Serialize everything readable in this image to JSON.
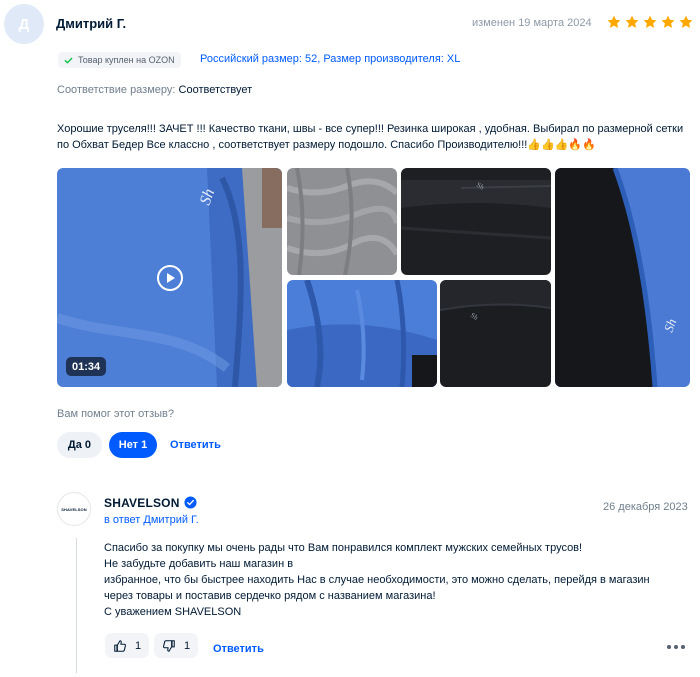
{
  "review": {
    "avatar_letter": "Д",
    "author": "Дмитрий Г.",
    "edited": "изменен 19 марта 2024",
    "rating": 5,
    "star_color": "#ffa800",
    "badge": "Товар куплен на OZON",
    "size_info": "Российский размер: 52, Размер производителя: XL",
    "fit_label": "Соответствие размеру:",
    "fit_value": "Соответствует",
    "text": "Хорошие труселя!!! ЗАЧЕТ !!! Качество ткани, швы - все супер!!! Резинка широкая , удобная. Выбирал по размерной сетки по Обхват Бедер Все классно , соответствует размеру подошло. Спасибо Производителю!!!👍👍👍🔥🔥",
    "video_duration": "01:34",
    "helpful_question": "Вам помог этот отзыв?",
    "yes_label": "Да 0",
    "no_label": "Нет 1",
    "reply_label": "Ответить"
  },
  "answer": {
    "seller_logo_text": "SHAVELSON",
    "seller_name": "SHAVELSON",
    "in_reply": "в ответ Дмитрий Г.",
    "date": "26 декабря 2023",
    "lines": [
      "Спасибо за покупку мы очень рады что Вам понравился комплект мужских семейных трусов!",
      "Не забудьте добавить наш магазин в",
      "избранное, что бы быстрее находить Нас в случае необходимости, это можно сделать, перейдя в магазин",
      "через товары и поставив сердечко рядом с названием магазина!",
      "С уважением SHAVELSON"
    ],
    "likes": "1",
    "dislikes": "1",
    "reply_label": "Ответить"
  },
  "colors": {
    "accent": "#005bff",
    "verified": "#005bff"
  }
}
